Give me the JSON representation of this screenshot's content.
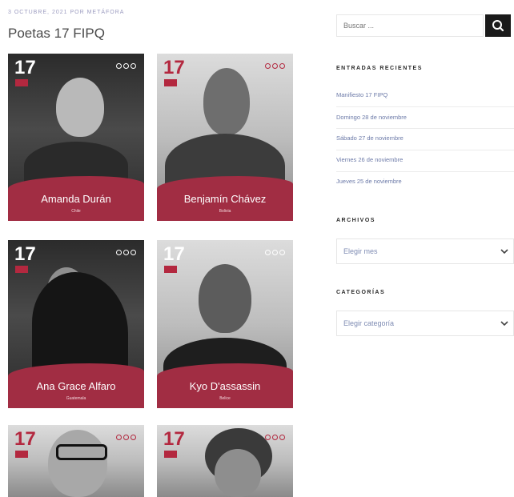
{
  "post": {
    "meta": "3 OCTUBRE, 2021 POR METÁFORA",
    "title": "Poetas 17 FIPQ"
  },
  "cards": [
    {
      "number": "17",
      "name": "Amanda Durán",
      "country": "Chile"
    },
    {
      "number": "17",
      "name": "Benjamín Chávez",
      "country": "Bolivia"
    },
    {
      "number": "17",
      "name": "Ana Grace Alfaro",
      "country": "Guatemala"
    },
    {
      "number": "17",
      "name": "Kyo D'assassin",
      "country": "Belice"
    },
    {
      "number": "17"
    },
    {
      "number": "17"
    }
  ],
  "sidebar": {
    "search_placeholder": "Buscar ...",
    "recent_heading": "ENTRADAS RECIENTES",
    "recent": [
      "Manifiesto 17 FIPQ",
      "Domingo 28 de noviembre",
      "Sábado 27 de noviembre",
      "Viernes 26 de noviembre",
      "Jueves 25 de noviembre"
    ],
    "archives_heading": "ARCHIVOS",
    "archives_select": "Elegir mes",
    "categories_heading": "CATEGORÍAS",
    "categories_select": "Elegir categoría"
  },
  "colors": {
    "brand_red": "#a12d43",
    "link": "#6c7aa8",
    "button": "#1a1a1a"
  },
  "icons": {
    "search": "search-icon",
    "chevron": "chevron-down-icon",
    "card_logo": "dots-logo-icon"
  }
}
